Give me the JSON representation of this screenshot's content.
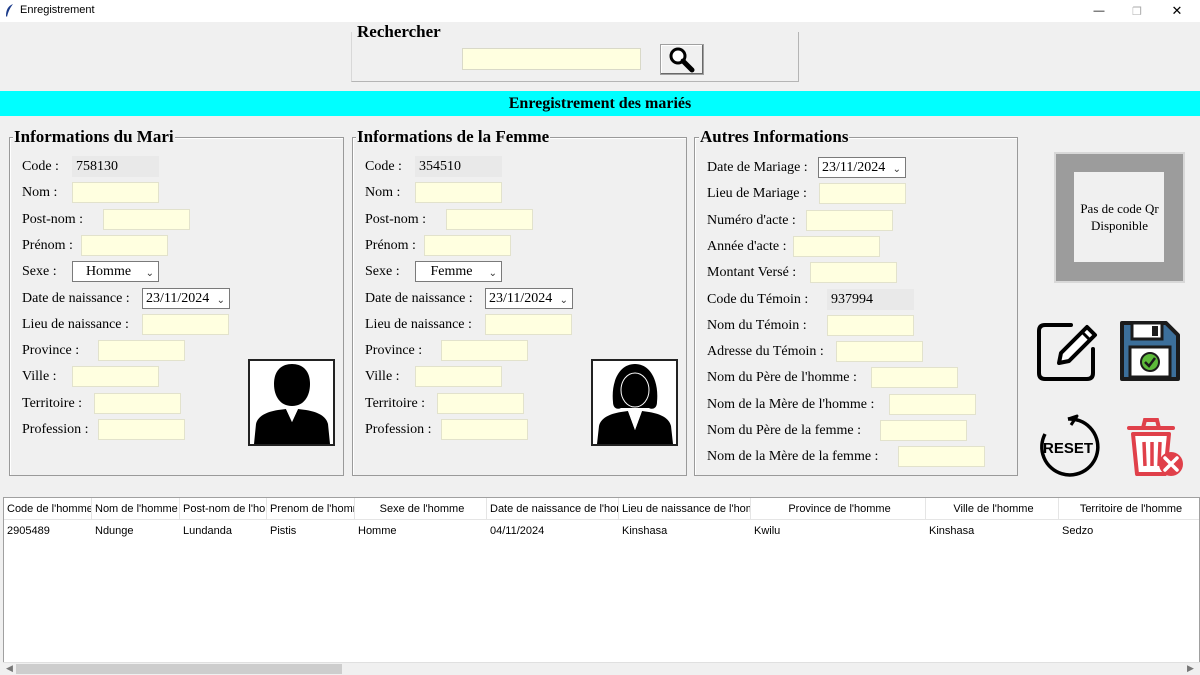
{
  "window": {
    "title": "Enregistrement",
    "controls": {
      "minimize": "—",
      "maximize": "❐",
      "close": "✕"
    }
  },
  "search": {
    "label": "Rechercher",
    "value": "",
    "button_icon": "search-icon"
  },
  "banner": {
    "title": "Enregistrement des mariés"
  },
  "husband": {
    "title": "Informations du Mari",
    "fields": [
      {
        "label": "Code :",
        "value": "758130"
      },
      {
        "label": "Nom :",
        "value": ""
      },
      {
        "label": "Post-nom :",
        "value": ""
      },
      {
        "label": "Prénom :",
        "value": ""
      },
      {
        "label": "Sexe :",
        "value": "Homme"
      },
      {
        "label": "Date de naissance :",
        "value": "23/11/2024"
      },
      {
        "label": "Lieu de naissance :",
        "value": ""
      },
      {
        "label": "Province :",
        "value": ""
      },
      {
        "label": "Ville :",
        "value": ""
      },
      {
        "label": "Territoire :",
        "value": ""
      },
      {
        "label": "Profession :",
        "value": ""
      }
    ],
    "photo_icon": "male-avatar-icon"
  },
  "wife": {
    "title": "Informations de la Femme",
    "fields": [
      {
        "label": "Code :",
        "value": "354510"
      },
      {
        "label": "Nom :",
        "value": ""
      },
      {
        "label": "Post-nom :",
        "value": ""
      },
      {
        "label": "Prénom :",
        "value": ""
      },
      {
        "label": "Sexe :",
        "value": "Femme"
      },
      {
        "label": "Date de naissance :",
        "value": "23/11/2024"
      },
      {
        "label": "Lieu de naissance :",
        "value": ""
      },
      {
        "label": "Province :",
        "value": ""
      },
      {
        "label": "Ville :",
        "value": ""
      },
      {
        "label": "Territoire :",
        "value": ""
      },
      {
        "label": "Profession :",
        "value": ""
      }
    ],
    "photo_icon": "female-avatar-icon"
  },
  "other": {
    "title": "Autres Informations",
    "fields": [
      {
        "label": "Date de Mariage :",
        "value": "23/11/2024"
      },
      {
        "label": "Lieu de Mariage :",
        "value": ""
      },
      {
        "label": "Numéro d'acte :",
        "value": ""
      },
      {
        "label": "Année d'acte :",
        "value": ""
      },
      {
        "label": "Montant Versé :",
        "value": ""
      },
      {
        "label": "Code du Témoin :",
        "value": "937994"
      },
      {
        "label": "Nom du Témoin :",
        "value": ""
      },
      {
        "label": "Adresse du Témoin :",
        "value": ""
      },
      {
        "label": "Nom du Père de l'homme :",
        "value": ""
      },
      {
        "label": "Nom de la Mère de l'homme :",
        "value": ""
      },
      {
        "label": "Nom du Père de la femme :",
        "value": ""
      },
      {
        "label": "Nom de la Mère de la femme :",
        "value": ""
      }
    ]
  },
  "qr": {
    "text": "Pas de code Qr Disponible"
  },
  "actions": {
    "edit_icon": "edit-icon",
    "save_icon": "save-icon",
    "reset_label": "RESET",
    "delete_icon": "delete-icon"
  },
  "table": {
    "columns": [
      "Code de l'homme",
      "Nom de l'homme",
      "Post-nom de l'homme",
      "Prenom de l'homme",
      "Sexe de l'homme",
      "Date de naissance de l'homme",
      "Lieu de naissance de l'homme",
      "Province de l'homme",
      "Ville de l'homme",
      "Territoire de l'homme"
    ],
    "rows": [
      [
        "2905489",
        "Ndunge",
        "Lundanda",
        "Pistis",
        "Homme",
        "04/11/2024",
        "Kinshasa",
        "Kwilu",
        "Kinshasa",
        "Sedzo"
      ]
    ]
  }
}
